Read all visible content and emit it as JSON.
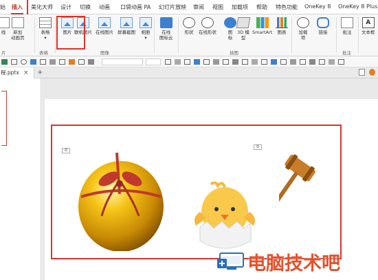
{
  "ribbon_tabs": [
    {
      "label": "始",
      "active": false
    },
    {
      "label": "插入",
      "active": true
    },
    {
      "label": "美化大师",
      "active": false
    },
    {
      "label": "设计",
      "active": false
    },
    {
      "label": "切换",
      "active": false
    },
    {
      "label": "动画",
      "active": false
    },
    {
      "label": "口袋动画 PA",
      "active": false
    },
    {
      "label": "幻灯片放映",
      "active": false
    },
    {
      "label": "审阅",
      "active": false
    },
    {
      "label": "视图",
      "active": false
    },
    {
      "label": "加载项",
      "active": false
    },
    {
      "label": "帮助",
      "active": false
    },
    {
      "label": "特色功能",
      "active": false
    },
    {
      "label": "OneKey 8",
      "active": false
    },
    {
      "label": "OneKey 8 Plus",
      "active": false
    }
  ],
  "ribbon": {
    "btn_newslide_partial": "线",
    "btn_newslide_partial2": "片",
    "btn_add_animation": "新加",
    "btn_add_animation2": "动画页",
    "btn_table": "表格",
    "btn_picture": "图片",
    "btn_camera": "联机图片",
    "btn_online_picture": "在线图片",
    "btn_screenshot": "屏幕截图",
    "btn_album": "相册",
    "btn_online_icons": "在线",
    "btn_online_icons2": "图标云",
    "btn_shapes": "形状",
    "btn_online_shapes": "在线形状",
    "btn_icons": "图",
    "btn_icons2": "标",
    "btn_3d": "3D 模",
    "btn_3d2": "型",
    "btn_smartart": "SmartArt",
    "btn_chart": "图表",
    "btn_addins": "加载",
    "btn_addins2": "项",
    "btn_link": "链接",
    "btn_comment": "批注",
    "btn_textbox": "文本框",
    "group_slides_partial": "片",
    "group_tables": "表格",
    "group_images": "图像",
    "group_illustrations": "插图",
    "group_comments": "批注"
  },
  "document_tab": {
    "name": "程.pptx",
    "close": "×",
    "add": "+"
  },
  "slide": {
    "badge_left": "0",
    "badge_right": "0"
  },
  "watermark": {
    "text": "电脑技术吧"
  },
  "colors": {
    "accent_red": "#d9342b",
    "watermark_orange": "#e2522b",
    "ribbon_blue": "#3d7fd0"
  }
}
